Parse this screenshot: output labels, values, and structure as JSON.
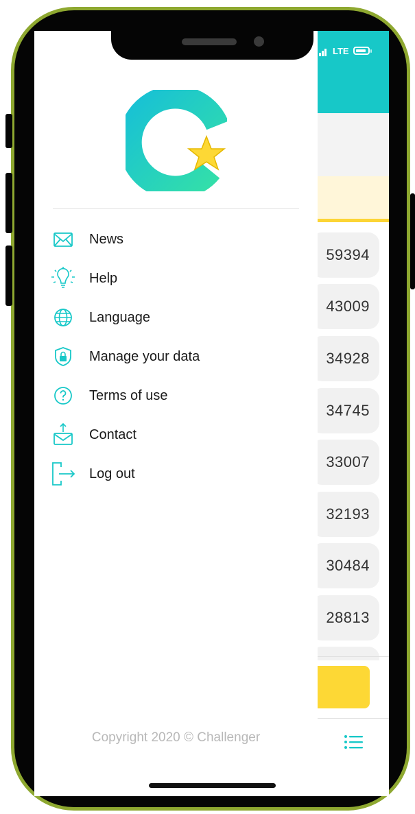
{
  "status_bar": {
    "network": "LTE"
  },
  "menu": {
    "items": [
      {
        "label": "News",
        "icon": "envelope-icon"
      },
      {
        "label": "Help",
        "icon": "lightbulb-icon"
      },
      {
        "label": "Language",
        "icon": "globe-icon"
      },
      {
        "label": "Manage your data",
        "icon": "shield-lock-icon"
      },
      {
        "label": "Terms of use",
        "icon": "question-circle-icon"
      },
      {
        "label": "Contact",
        "icon": "envelope-upload-icon"
      },
      {
        "label": "Log out",
        "icon": "logout-icon"
      }
    ]
  },
  "footer": {
    "copyright": "Copyright 2020 © Challenger"
  },
  "leaderboard": {
    "scores": [
      "59394",
      "43009",
      "34928",
      "34745",
      "33007",
      "32193",
      "30484",
      "28813"
    ]
  },
  "colors": {
    "accent": "#17c8c8",
    "highlight": "#fdd835",
    "frame": "#8ea830"
  }
}
